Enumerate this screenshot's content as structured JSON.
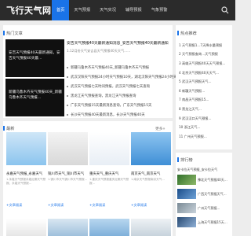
{
  "site": {
    "logo": "飞行天气网"
  },
  "nav": {
    "items": [
      "首页",
      "天气预报",
      "天气实况",
      "辅导预报",
      "气象预警"
    ],
    "active_index": 0
  },
  "hot": {
    "section_title": "热门文章",
    "main_overlay": "安吉天气预报40天最新通知，安吉天气预报40天最...",
    "sub_overlay": "新疆乌鲁木齐天气预报40天_新疆乌鲁木齐天气预报...",
    "headline": "安吉天气预报40天最新通知消息_安吉天气预报40天最新通知",
    "headline_desc": "1.12月份天气安吉县天气预报40天天气......",
    "list": [
      "新疆乌鲁木齐天气预报40天_新疆乌鲁木齐天气预报",
      "武汉汉阳天气预报24小时天气预报10天，湖北汉阳天气预报24小时天气",
      "武汉天气预报七天时间预报，武汉天气预报七天查询",
      "黑龙江天气预报查询，黑龙江天气预报查询",
      "广东天气预报15天最新消息查询，广东天气预报15天",
      "长沙天气预报40天最新消息，长沙天气预报40天"
    ]
  },
  "recommend": {
    "section_title": "热点推荐",
    "items": [
      "1 天气预报1...7天降水量预报",
      "2 天气预报查询...天气预报",
      "3 高雄天气预报40天天气预报...",
      "4 北京天气预报40天天气...",
      "5 武汉天气预报天气...",
      "6 新疆天气预报...",
      "7 南昌天气预报15...",
      "8 黑龙江天气...",
      "9 武汉汉口天气预报...",
      "10 浙江天气...",
      "11 广州天气预报..."
    ]
  },
  "ranking": {
    "section_title": "排行榜",
    "items": [
      "安卡拉天气预报_安卡拉天气",
      "豫北天气预报40天...",
      "广西天气预报天气...",
      "广州天气预报...",
      "上海天气预报15天..."
    ]
  },
  "latest": {
    "section_title": "最新",
    "more_label": "更多»",
    "posts": [
      {
        "title": "永嘉天气预报_永嘉天气",
        "snippet": "1.永嘉天气预报永嘉近期天气预报，永嘉天气预报...",
        "read": "+文章阅读"
      },
      {
        "title": "铜川市天气_铜川市天气",
        "snippet": "1.铜川市天气铜川市天气预报...",
        "read": "+文章阅读"
      },
      {
        "title": "重庆天气_重庆天气",
        "snippet": "1.重庆天气预报重庆近期天气预报...",
        "read": "+文章阅读"
      },
      {
        "title": "南京天气_南京天气",
        "snippet": "1.南京天气预报南京天气...",
        "read": "+文章阅读"
      }
    ]
  },
  "colors": {
    "accent": "#1a73e8",
    "topbar": "#2b2b2b",
    "page": "#ededed"
  }
}
